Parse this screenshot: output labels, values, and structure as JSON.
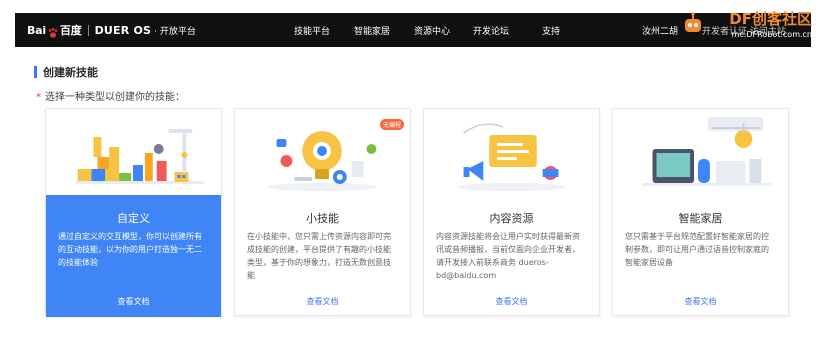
{
  "brand": {
    "logo_text_a": "Bai",
    "logo_text_b": "百度",
    "product": "DUER OS",
    "subtitle": "· 开放平台"
  },
  "nav": {
    "items": [
      "技能平台",
      "智能家居",
      "资源中心",
      "开发论坛",
      "支持"
    ],
    "right_item": "汝州二胡"
  },
  "watermark": {
    "title": "DF创客社区",
    "url": "mc.DFRobot.com.cn",
    "overlay_text": "开发者认证 访问主站"
  },
  "section": {
    "title": "创建新技能",
    "required_mark": "*",
    "prompt": "选择一种类型以创建你的技能："
  },
  "cards": [
    {
      "title": "自定义",
      "desc": "通过自定义的交互模型，你可以创建所有的互动技能，以为你的用户打造独一无二的技能体验",
      "link": "查看文档",
      "selected": true
    },
    {
      "title": "小技能",
      "desc": "在小技能中，您只需上传资源内容即可完成技能的创建，平台提供了有趣的小技能类型，基于你的想象力，打造无数创意技能",
      "link": "查看文档",
      "badge": "无编程"
    },
    {
      "title": "内容资源",
      "desc": "内容资源技能将会让用户实时获得最新资讯或音频播报，当前仅面向企业开发者，请开发接入前联系商务 dueros-bd@baidu.com",
      "link": "查看文档"
    },
    {
      "title": "智能家居",
      "desc": "您只需基于平台规范配置好智能家居的控制参数，即可让用户通过语音控制家庭的智能家居设备",
      "link": "查看文档"
    }
  ],
  "colors": {
    "accent": "#3f85f6",
    "topbar": "#101010",
    "badge": "#f26a3c",
    "required": "#e83d3d"
  }
}
